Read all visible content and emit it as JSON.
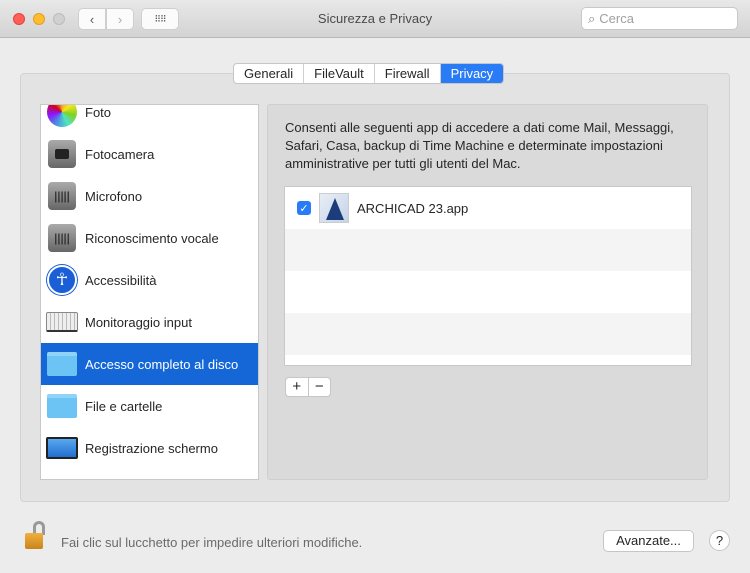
{
  "window": {
    "title": "Sicurezza e Privacy",
    "search_placeholder": "Cerca"
  },
  "tabs": [
    {
      "label": "Generali"
    },
    {
      "label": "FileVault"
    },
    {
      "label": "Firewall"
    },
    {
      "label": "Privacy",
      "active": true
    }
  ],
  "sidebar": {
    "items": [
      {
        "label": "Foto",
        "icon": "photos-icon"
      },
      {
        "label": "Fotocamera",
        "icon": "camera-icon"
      },
      {
        "label": "Microfono",
        "icon": "microphone-icon"
      },
      {
        "label": "Riconoscimento vocale",
        "icon": "speech-recognition-icon"
      },
      {
        "label": "Accessibilità",
        "icon": "accessibility-icon"
      },
      {
        "label": "Monitoraggio input",
        "icon": "keyboard-icon"
      },
      {
        "label": "Accesso completo al disco",
        "icon": "folder-icon",
        "selected": true
      },
      {
        "label": "File e cartelle",
        "icon": "folder-icon"
      },
      {
        "label": "Registrazione schermo",
        "icon": "display-icon"
      }
    ]
  },
  "panel": {
    "description": "Consenti alle seguenti app di accedere a dati come Mail, Messaggi, Safari, Casa, backup di Time Machine e determinate impostazioni amministrative per tutti gli utenti del Mac.",
    "apps": [
      {
        "name": "ARCHICAD 23.app",
        "checked": true
      }
    ],
    "add_label": "+",
    "remove_label": "−"
  },
  "footer": {
    "lock_text": "Fai clic sul lucchetto per impedire ulteriori modifiche.",
    "advanced_label": "Avanzate...",
    "help_label": "?"
  },
  "colors": {
    "accent": "#2a7cf6",
    "selection": "#1567d8"
  }
}
